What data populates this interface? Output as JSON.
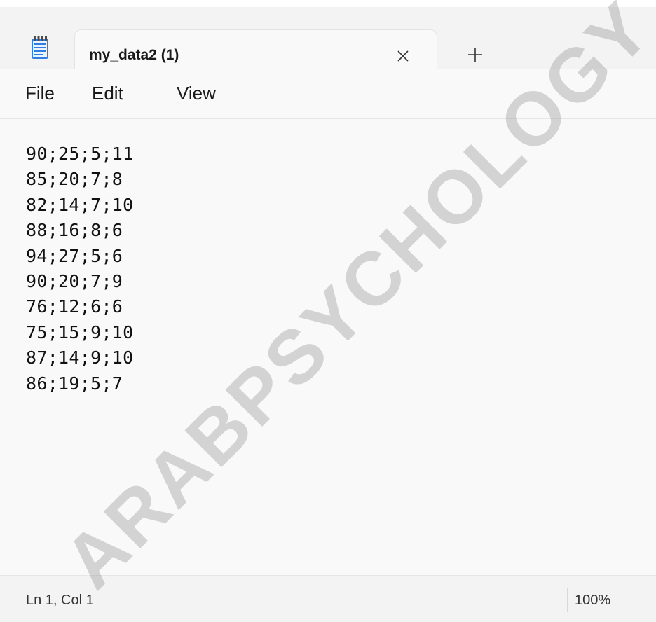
{
  "window": {
    "tab_title": "my_data2 (1)",
    "close_tab_icon": "close-icon",
    "new_tab_icon": "plus-icon",
    "app_icon": "notepad-icon"
  },
  "menu": {
    "file": "File",
    "edit": "Edit",
    "view": "View"
  },
  "editor": {
    "lines": [
      "90;25;5;11",
      "85;20;7;8",
      "82;14;7;10",
      "88;16;8;6",
      "94;27;5;6",
      "90;20;7;9",
      "76;12;6;6",
      "75;15;9;10",
      "87;14;9;10",
      "86;19;5;7"
    ]
  },
  "status": {
    "position": "Ln 1, Col 1",
    "zoom": "100%"
  },
  "watermark": "ARABPSYCHOLOGY",
  "colors": {
    "accent": "#3a7bd5",
    "text": "#1a1a1a"
  }
}
